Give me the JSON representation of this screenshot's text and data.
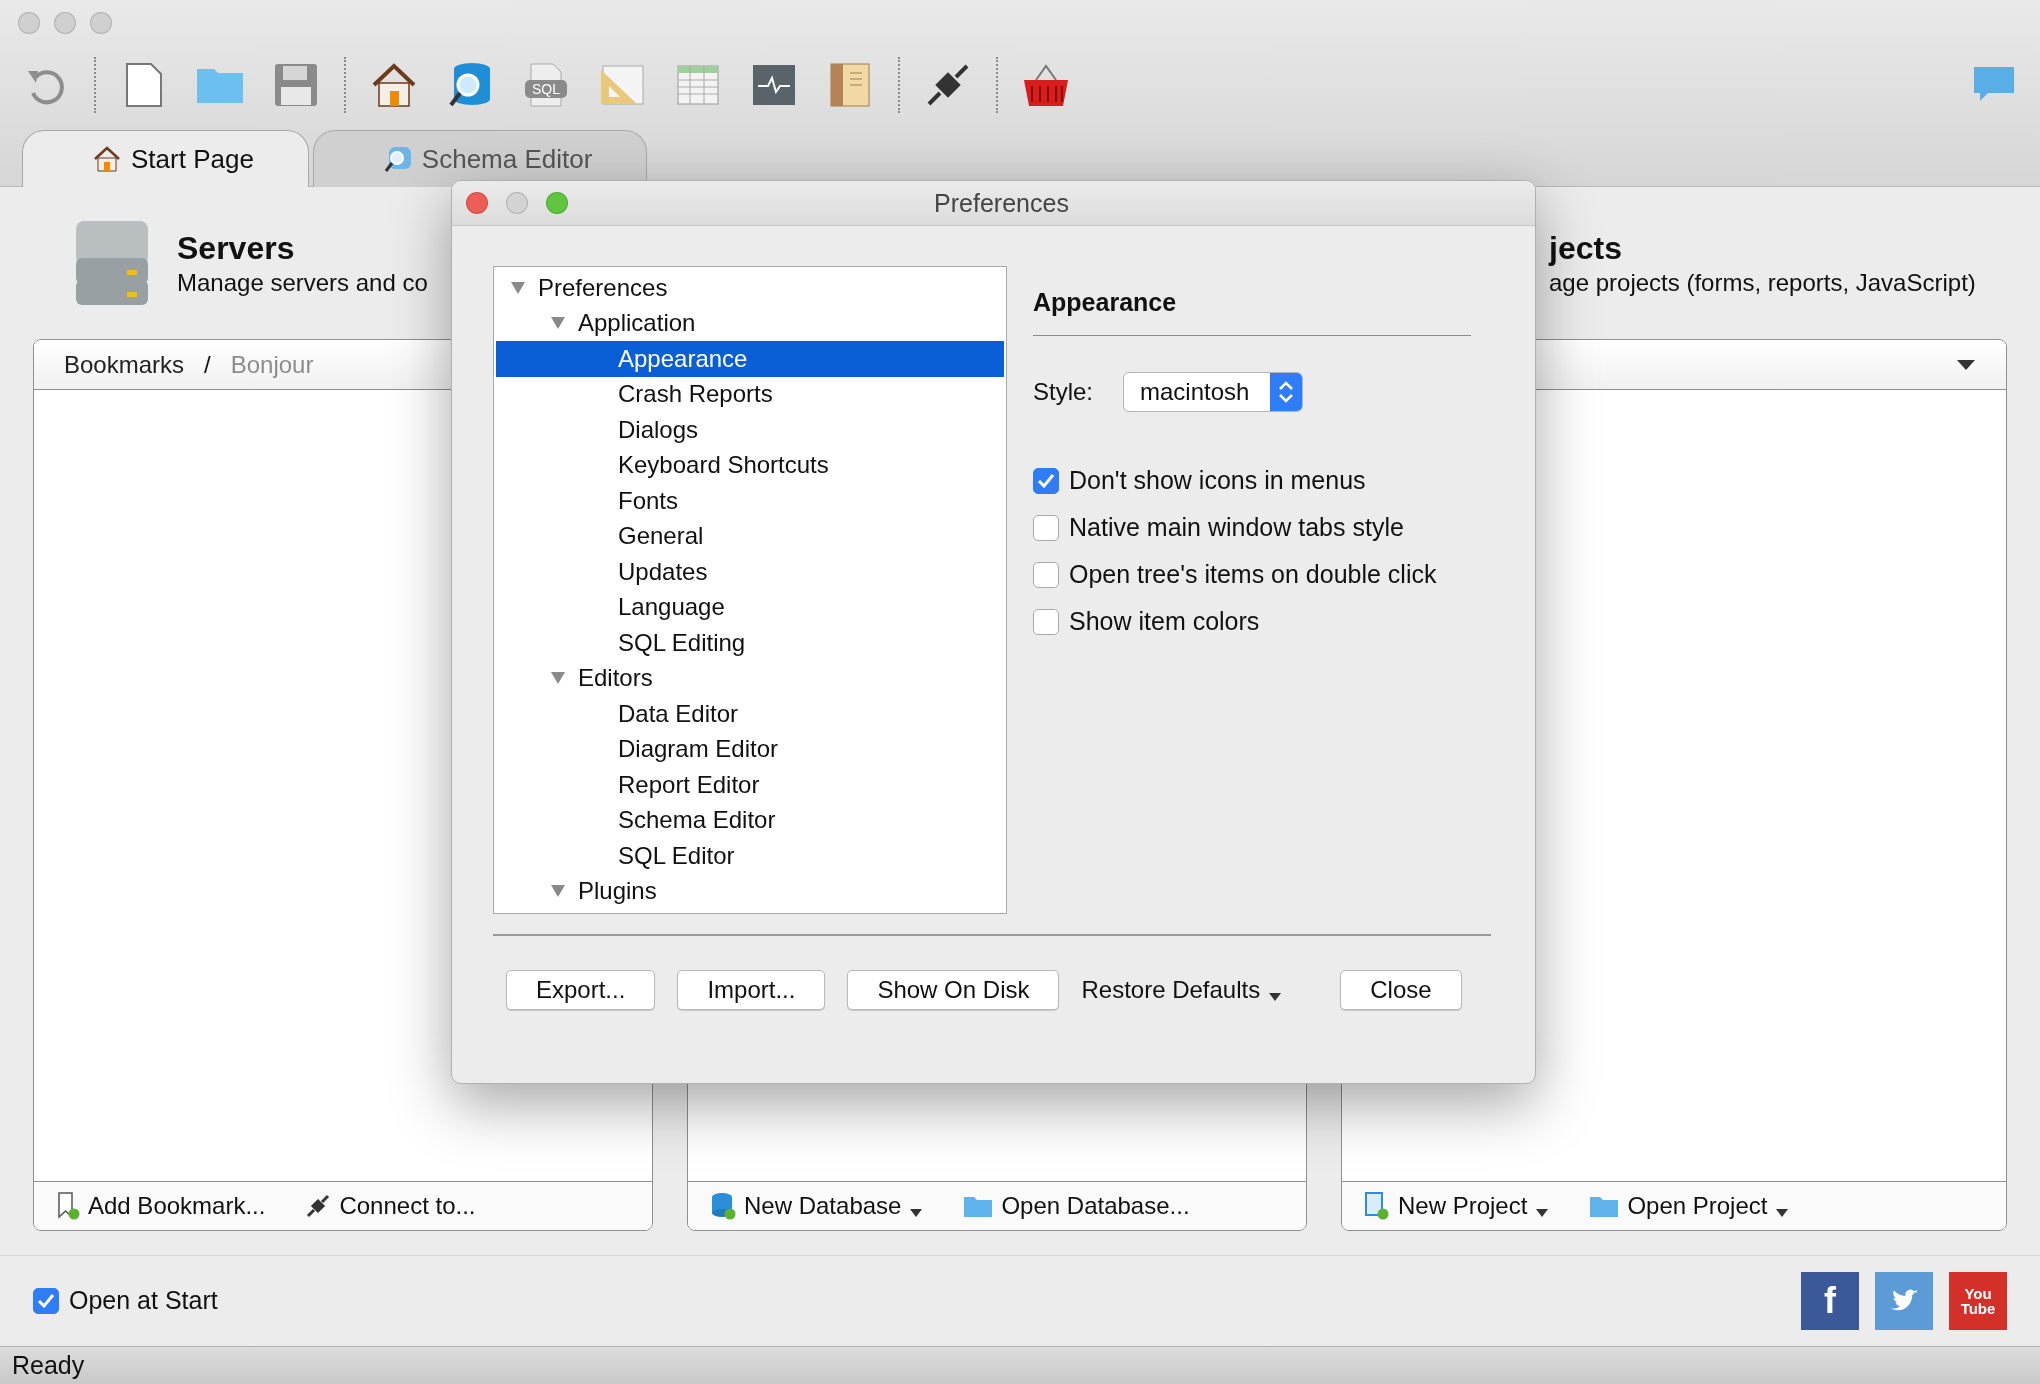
{
  "toolbar": {
    "sql_label": "SQL"
  },
  "tabs": [
    {
      "label": "Start Page",
      "selected": true,
      "kind": "home"
    },
    {
      "label": "Schema Editor",
      "selected": false,
      "kind": "schema"
    }
  ],
  "servers": {
    "title": "Servers",
    "subtitle": "Manage servers and co"
  },
  "projects": {
    "title": "jects",
    "subtitle": "age projects (forms, reports, JavaScript)"
  },
  "bookmarks_bar": {
    "separator": "/",
    "items": [
      {
        "label": "Bookmarks",
        "selected": true
      },
      {
        "label": "Bonjour",
        "selected": false
      }
    ]
  },
  "panels": [
    {
      "actions": [
        {
          "label": "Add Bookmark...",
          "kind": "bookmark",
          "menu": false
        },
        {
          "label": "Connect to...",
          "kind": "plug",
          "menu": false
        }
      ]
    },
    {
      "actions": [
        {
          "label": "New Database",
          "kind": "database",
          "menu": true
        },
        {
          "label": "Open Database...",
          "kind": "folder",
          "menu": false
        }
      ]
    },
    {
      "actions": [
        {
          "label": "New Project",
          "kind": "project",
          "menu": true
        },
        {
          "label": "Open Project",
          "kind": "folder",
          "menu": true
        }
      ]
    }
  ],
  "open_at_start": {
    "label": "Open at Start",
    "checked": true
  },
  "social": [
    {
      "kind": "facebook",
      "color": "#3b5998",
      "label": [
        "f"
      ]
    },
    {
      "kind": "twitter",
      "color": "#5d9bd6"
    },
    {
      "kind": "youtube",
      "color": "#d3302a",
      "label": [
        "You",
        "Tube"
      ]
    }
  ],
  "status_bar": "Ready",
  "dialog": {
    "title": "Preferences",
    "tree": [
      {
        "label": "Preferences",
        "expanded": true,
        "selected": false,
        "children": [
          {
            "label": "Application",
            "expanded": true,
            "selected": false,
            "children": [
              {
                "label": "Appearance",
                "selected": true
              },
              {
                "label": "Crash Reports",
                "selected": false
              },
              {
                "label": "Dialogs",
                "selected": false
              },
              {
                "label": "Keyboard Shortcuts",
                "selected": false
              },
              {
                "label": "Fonts",
                "selected": false
              },
              {
                "label": "General",
                "selected": false
              },
              {
                "label": "Updates",
                "selected": false
              },
              {
                "label": "Language",
                "selected": false
              },
              {
                "label": "SQL Editing",
                "selected": false
              }
            ]
          },
          {
            "label": "Editors",
            "expanded": true,
            "selected": false,
            "children": [
              {
                "label": "Data Editor",
                "selected": false
              },
              {
                "label": "Diagram Editor",
                "selected": false
              },
              {
                "label": "Report Editor",
                "selected": false
              },
              {
                "label": "Schema Editor",
                "selected": false
              },
              {
                "label": "SQL Editor",
                "selected": false
              }
            ]
          },
          {
            "label": "Plugins",
            "expanded": true,
            "selected": false
          }
        ]
      }
    ],
    "section_title": "Appearance",
    "style": {
      "label": "Style:",
      "value": "macintosh"
    },
    "options": [
      {
        "label": "Don't show icons in menus",
        "checked": true
      },
      {
        "label": "Native main window tabs style",
        "checked": false
      },
      {
        "label": "Open tree's items on double click",
        "checked": false
      },
      {
        "label": "Show item colors",
        "checked": false
      }
    ],
    "buttons": [
      {
        "label": "Export...",
        "kind": "button"
      },
      {
        "label": "Import...",
        "kind": "button"
      },
      {
        "label": "Show On Disk",
        "kind": "button"
      },
      {
        "label": "Restore Defaults",
        "kind": "menu"
      },
      {
        "label": "Close",
        "kind": "button"
      }
    ]
  }
}
